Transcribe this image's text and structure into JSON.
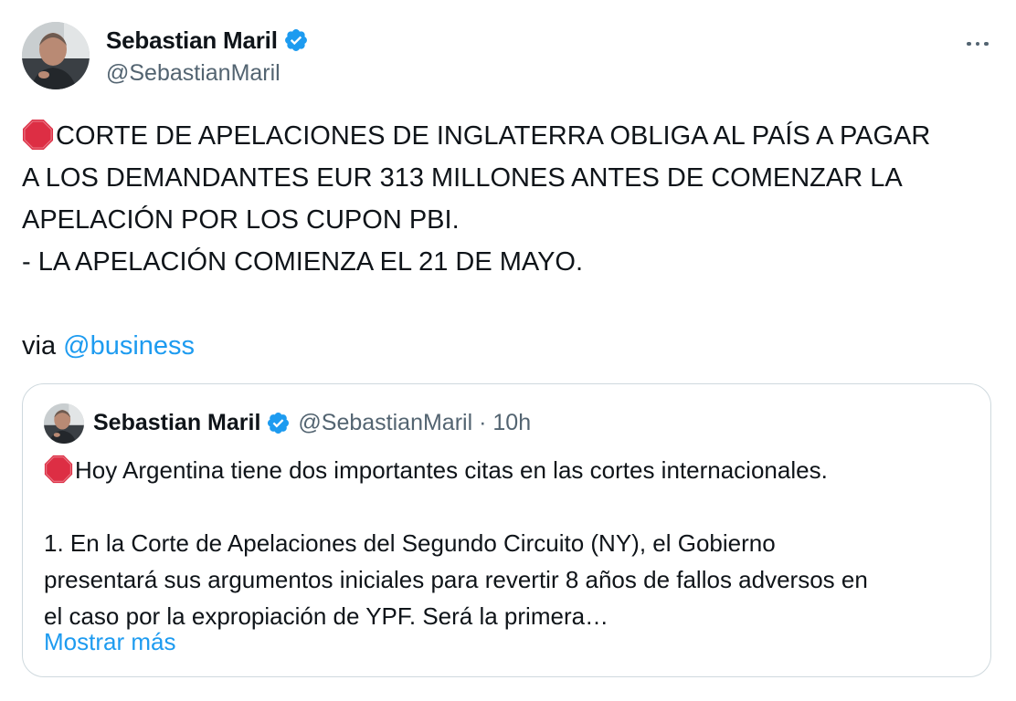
{
  "tweet": {
    "author": {
      "display_name": "Sebastian Maril",
      "handle": "@SebastianMaril",
      "verified": true
    },
    "body_lines": [
      "CORTE DE APELACIONES DE INGLATERRA OBLIGA AL PAÍS A PAGAR",
      "A LOS DEMANDANTES EUR 313 MILLONES ANTES DE COMENZAR LA",
      "APELACIÓN POR LOS CUPON PBI.",
      "- LA APELACIÓN COMIENZA EL 21 DE MAYO."
    ],
    "via_prefix": "via",
    "via_mention": "@business",
    "leading_emoji": "stop-sign-icon"
  },
  "quoted_tweet": {
    "display_name": "Sebastian Maril",
    "handle": "@SebastianMaril",
    "separator": "·",
    "time": "10h",
    "verified": true,
    "lines": [
      "Hoy Argentina tiene dos importantes citas en las cortes internacionales.",
      "1. En la Corte de Apelaciones del Segundo Circuito (NY), el Gobierno",
      "presentará sus argumentos iniciales para revertir 8 años de fallos adversos en",
      "el caso por la expropiación de YPF. Será la primera…"
    ],
    "show_more": "Mostrar más"
  },
  "colors": {
    "text": "#0f1419",
    "secondary": "#536471",
    "link": "#1d9bf0",
    "border": "#cfd9de",
    "stop_red": "#dd2e44"
  }
}
